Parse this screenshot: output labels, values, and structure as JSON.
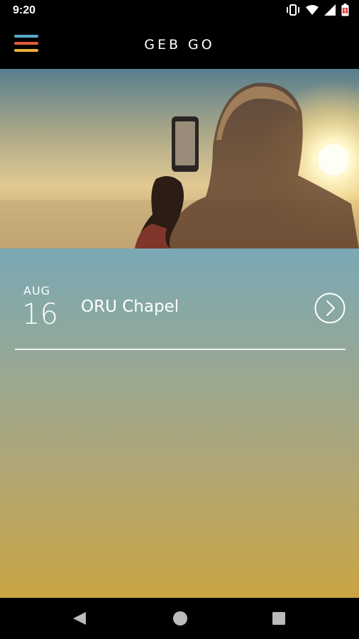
{
  "status_bar": {
    "time": "9:20",
    "icons": [
      "vibrate-icon",
      "wifi-icon",
      "signal-icon",
      "battery-icon"
    ]
  },
  "app_bar": {
    "title": "GEB GO",
    "menu_icon": "hamburger-menu-icon",
    "menu_colors": [
      "#5aa9c9",
      "#e25b3b",
      "#e8b23a"
    ]
  },
  "hero": {
    "description_icon": "hero-image"
  },
  "events": [
    {
      "month": "AUG",
      "day": "16",
      "title": "ORU Chapel",
      "action_icon": "chevron-right-circle-icon"
    }
  ],
  "nav_bar": {
    "icons": [
      "back-icon",
      "home-icon",
      "recents-icon"
    ]
  }
}
